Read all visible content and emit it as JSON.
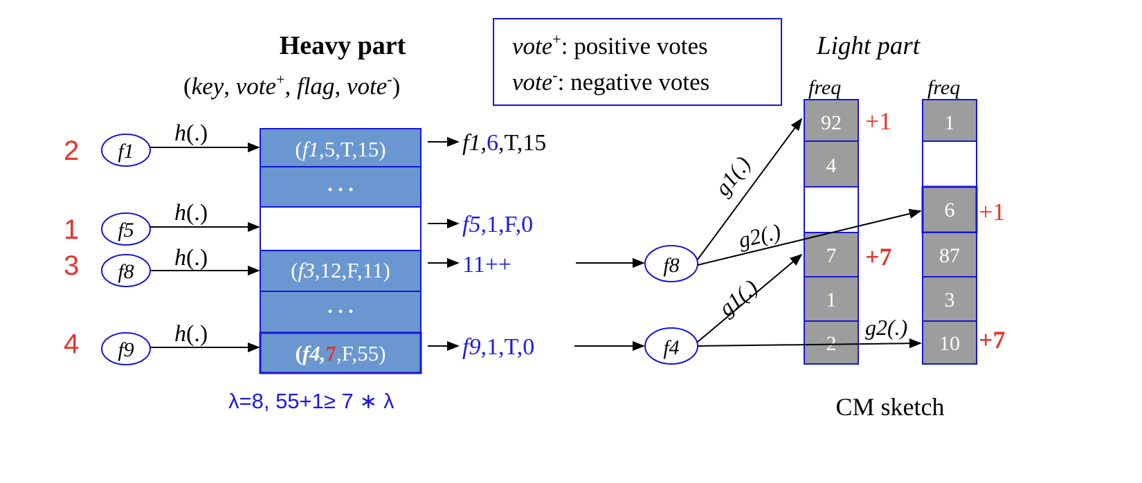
{
  "colors": {
    "blue_cell": "#6a97cf",
    "gray_cell": "#9d9d9d",
    "border_blue": "#1515d8",
    "text_blue": "#1a1ae6",
    "red": "#e8322a",
    "black": "#000000"
  },
  "heavy": {
    "title": "Heavy part",
    "fields_open": "(",
    "fields_key": "key",
    "fields_comma": ", ",
    "fields_vote": "vote",
    "fields_plus": "+",
    "fields_flag": "flag",
    "fields_minus": "-",
    "fields_close": ")",
    "sep": ", ",
    "row1": "(f1,5,T,15)",
    "row1_key": "f1",
    "row1_rest": ",5,T,15)",
    "row2_dots": ". . .",
    "row4_key": "f3,",
    "row4_rest": "12,F,11)",
    "row5_dots": ". . .",
    "row6_key": "f4,",
    "row6_vote": "7",
    "row6_rest": ",F,55)",
    "lambda_line": "λ=8, 55+1≥ 7 ∗ λ"
  },
  "legend": {
    "vote": "vote",
    "plus": "+",
    "minus": "-",
    "line1_text": ": positive votes",
    "line2_text": ": negative votes"
  },
  "light": {
    "title": "Light part",
    "freq": "freq",
    "col1": [
      "92",
      "4",
      "",
      "7",
      "1",
      "2"
    ],
    "col2": [
      "1",
      "",
      "6",
      "87",
      "3",
      "10"
    ],
    "col1_marks": {
      "row0": "+1",
      "row3": "+7"
    },
    "col2_marks": {
      "row2": "+1",
      "row5": "+7"
    },
    "caption": "CM sketch"
  },
  "flows": [
    {
      "step": "2",
      "flow": "f1",
      "hash": "h(.)"
    },
    {
      "step": "1",
      "flow": "f5",
      "hash": "h(.)"
    },
    {
      "step": "3",
      "flow": "f8",
      "hash": "h(.)"
    },
    {
      "step": "4",
      "flow": "f9",
      "hash": "h(.)"
    }
  ],
  "results": {
    "r1_key": "f1,",
    "r1_vote": "6",
    "r1_rest": ",T,15",
    "r2": "f5,1,F,0",
    "r2_key": "f5,",
    "r2_rest": "1,F,0",
    "r3": "11++",
    "r4_key": "f9,",
    "r4_rest": "1,T,0"
  },
  "light_flows": {
    "f8": "f8",
    "f4": "f4",
    "g1": "g1(.)",
    "g2": "g2(.)"
  }
}
